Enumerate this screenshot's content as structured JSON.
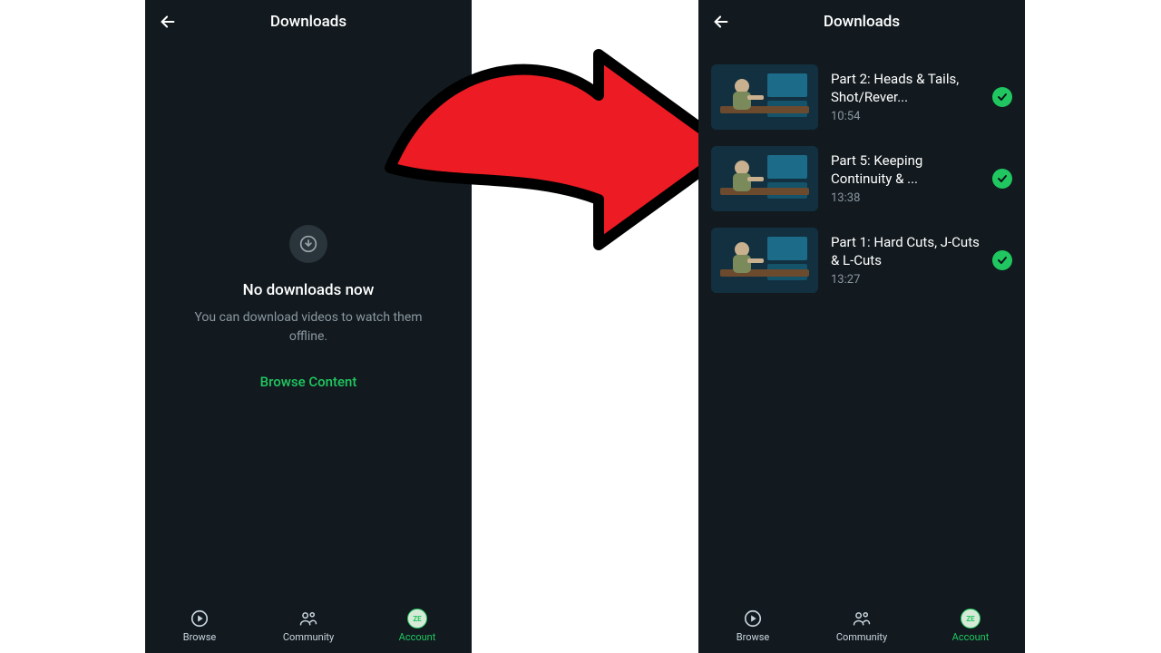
{
  "left": {
    "appbar": {
      "title": "Downloads"
    },
    "empty": {
      "title": "No downloads now",
      "sub": "You can download videos to watch them offline.",
      "browse": "Browse Content"
    },
    "tabs": {
      "browse": "Browse",
      "community": "Community",
      "account": "Account",
      "avatar_initials": "ZE"
    }
  },
  "right": {
    "appbar": {
      "title": "Downloads"
    },
    "items": [
      {
        "title": "Part 2: Heads & Tails, Shot/Rever...",
        "duration": "10:54"
      },
      {
        "title": "Part 5: Keeping Continuity & ...",
        "duration": "13:38"
      },
      {
        "title": "Part 1: Hard Cuts, J-Cuts & L-Cuts",
        "duration": "13:27"
      }
    ],
    "tabs": {
      "browse": "Browse",
      "community": "Community",
      "account": "Account",
      "avatar_initials": "ZE"
    }
  },
  "colors": {
    "accent": "#20c760",
    "bg": "#121a1f",
    "subtext": "#8b97a0",
    "arrow_fill": "#ed1c24"
  }
}
